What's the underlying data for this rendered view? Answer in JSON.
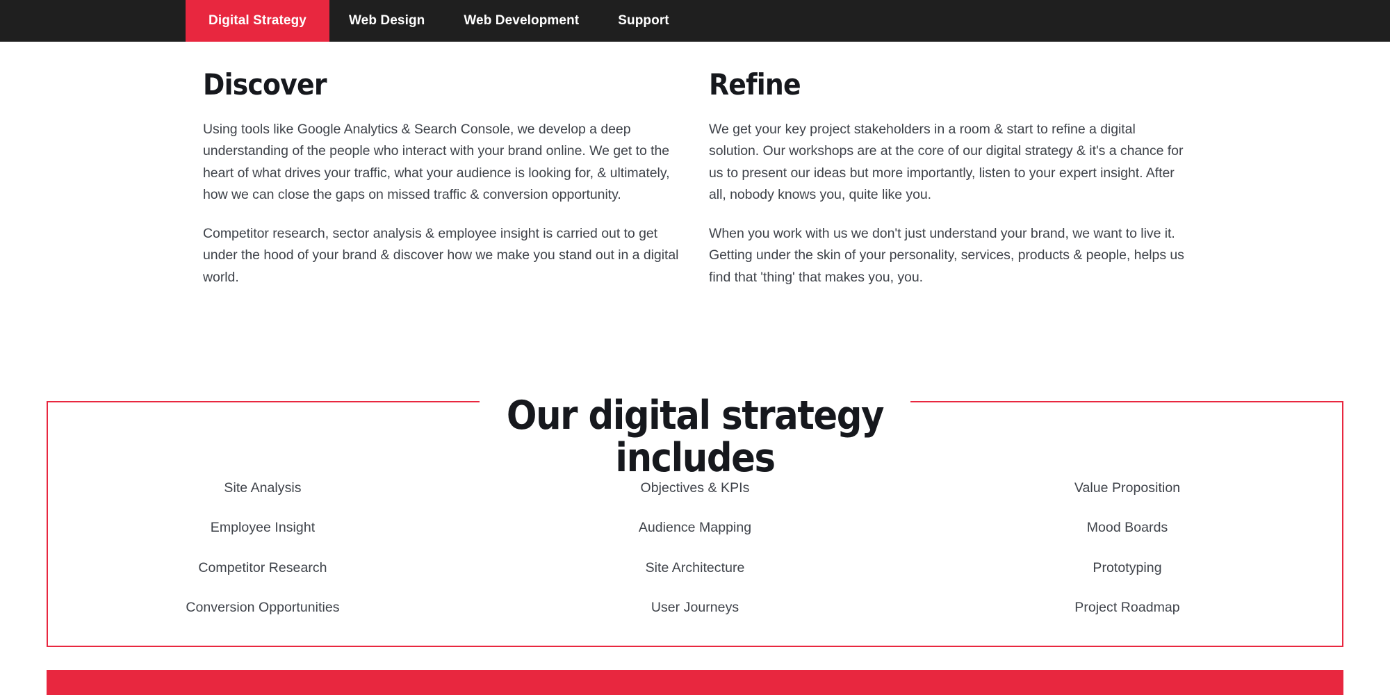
{
  "theme": {
    "accent_red": "#E8273F",
    "nav_background": "#1f1f1f",
    "text_dark": "#16181d",
    "text_body": "#3e4249",
    "page_background": "#ffffff"
  },
  "nav": {
    "items": [
      {
        "label": "Digital Strategy",
        "active": true
      },
      {
        "label": "Web Design",
        "active": false
      },
      {
        "label": "Web Development",
        "active": false
      },
      {
        "label": "Support",
        "active": false
      }
    ]
  },
  "intro": {
    "columns": [
      {
        "heading": "Discover",
        "paragraphs": [
          "Using tools like Google Analytics & Search Console, we develop a deep understanding of the people who interact with your brand online. We get to the heart of what drives your traffic, what your audience is looking for, & ultimately, how we can close the gaps on missed traffic & conversion opportunity.",
          "Competitor research, sector analysis & employee insight is carried out to get under the hood of your brand & discover how we make you stand out in a digital world."
        ]
      },
      {
        "heading": "Refine",
        "paragraphs": [
          "We get your key project stakeholders in a room & start to refine a digital solution. Our workshops are at the core of our digital strategy & it's a chance for us to present our ideas but more importantly, listen to your expert insight. After all, nobody knows you, quite like you.",
          "When you work with us we don't just understand your brand, we want to live it. Getting under the skin of your personality, services, products & people, helps us find that 'thing' that makes you, you."
        ]
      }
    ]
  },
  "strategy": {
    "title_line1": "Our digital strategy",
    "title_line2": "includes",
    "columns": [
      {
        "items": [
          "Site Analysis",
          "Employee Insight",
          "Competitor Research",
          "Conversion Opportunities"
        ]
      },
      {
        "items": [
          "Objectives & KPIs",
          "Audience Mapping",
          "Site Architecture",
          "User Journeys"
        ]
      },
      {
        "items": [
          "Value Proposition",
          "Mood Boards",
          "Prototyping",
          "Project Roadmap"
        ]
      }
    ]
  }
}
